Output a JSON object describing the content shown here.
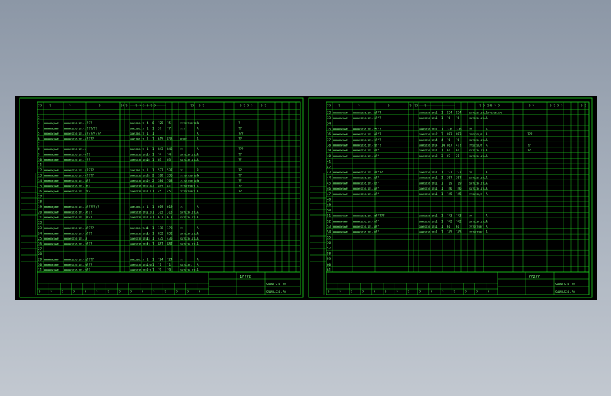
{
  "viewer": {
    "background_color": "#000000",
    "line_color": "#1fd61f",
    "text_color": "#7dff7d"
  },
  "sheets": [
    {
      "id": "sheet-left",
      "title_block": {
        "drawing_no": "SWWHLS38.78",
        "name_line": "1???2",
        "header_codes": [
          "7?",
          "?",
          "?",
          "?",
          "??",
          "?",
          "? ? ? ? ? ?",
          "??",
          "? ?",
          "? ? ? ?",
          "? ?"
        ],
        "footer_codes": [
          "?",
          "?",
          "?",
          "?",
          "?",
          "?",
          "?",
          "?",
          "?",
          "?",
          "?",
          "?",
          "?",
          "?",
          "?"
        ]
      },
      "rows": [
        {
          "n": "1"
        },
        {
          "n": "2"
        },
        {
          "n": "3",
          "a": "WWWWWW/WWW",
          "b": "WWWWHSJ36.17L-1",
          "c": "???",
          "d": "SAWSJ36.17",
          "q": "4",
          "u": "6",
          "v": "?25",
          "w": "?5",
          "x": "???SV7SB/?JLA",
          "y": "A",
          "z": "?"
        },
        {
          "n": "4",
          "a": "WWWWWW/WWW",
          "b": "WWWWHSJ36.17L-2",
          "c": "???/??",
          "d": "SAWSJ36.17",
          "q": "1",
          "u": "1",
          "v": "3?",
          "w": "?7",
          "x": "???",
          "y": "A",
          "z": "??"
        },
        {
          "n": "5",
          "a": "WWWWWW/WWW",
          "b": "WWWWHSJ36.17L-3",
          "c": "????/???",
          "d": "SAWSJ36.17",
          "q": "1",
          "u": "1",
          "v": "",
          "w": "",
          "x": "",
          "y": "A",
          "z": "???"
        },
        {
          "n": "6",
          "a": "WWWWWW/WWW",
          "b": "WWWWHSJ36.17L-4",
          "c": "????",
          "d": "SAWSJ36.17",
          "q": "1",
          "u": "1",
          "v": "615",
          "w": "835",
          "x": "838/3",
          "y": "A",
          "z": "??"
        },
        {
          "n": "7"
        },
        {
          "n": "8",
          "a": "WWWWWW/WWW",
          "b": "WWWWHSJ36.17L-5",
          "c": "",
          "d": "SAWSJ36.17",
          "q": "1",
          "u": "1",
          "v": "843",
          "w": "843",
          "x": "??",
          "y": "A",
          "z": "???"
        },
        {
          "n": "9",
          "a": "WWWWWW/WWW",
          "b": "WWWWHSJ36.17L-6",
          "c": "??",
          "d": "SAWHSJ36.17L-5",
          "q": "1",
          "u": "1",
          "v": "?4",
          "w": "?4",
          "x": "SA?SJ36.17LA",
          "y": "A",
          "z": "??"
        },
        {
          "n": "10",
          "a": "WWWWWW/WWW",
          "b": "WWWWHSJ36.17L-7",
          "c": "??",
          "d": "SAWHSJ36.17L-6",
          "q": "1",
          "u": "1",
          "v": "03",
          "w": "03",
          "x": "SA?SJ36.17LA",
          "y": "A",
          "z": "??"
        },
        {
          "n": "11"
        },
        {
          "n": "12",
          "a": "WWWWWW/WWW",
          "b": "WWWWHSJ36.17L-8",
          "c": "????",
          "d": "SAWSJ36.17",
          "q": "1",
          "u": "1",
          "v": "537",
          "w": "537",
          "x": "??",
          "y": "B",
          "z": "??"
        },
        {
          "n": "13",
          "a": "WWWWWW/WWW",
          "b": "WWWWHSJ36.17L-9",
          "c": "????",
          "d": "SAWHSJ36.17L-8",
          "q": "2",
          "u": "2",
          "v": "168",
          "w": "336",
          "x": "???SV7SB/?JLA",
          "y": "A",
          "z": "??"
        },
        {
          "n": "14",
          "a": "WWWWWW/WWW",
          "b": "WWWWHSJ36.17L-10",
          "c": "??",
          "d": "SAWHSJ36.17L-9",
          "q": "2",
          "u": "2",
          "v": "384",
          "w": "768",
          "x": "???SV7SB/?JLA",
          "y": "A",
          "z": "??"
        },
        {
          "n": "15",
          "a": "WWWWWW/WWW",
          "b": "WWWWHSJ36.17L-11",
          "c": "??",
          "d": "SAWHSJ36.17L-10",
          "q": "2",
          "u": "2",
          "v": "405",
          "w": "81",
          "x": "???SV7SB/?",
          "y": "A",
          "z": "??"
        },
        {
          "n": "16",
          "a": "WWWWWW/WWW",
          "b": "WWWWHSJ36.17L-12",
          "c": "??",
          "d": "SAWHSJ36.17L-11",
          "q": "1",
          "u": "1",
          "v": "45",
          "w": "45",
          "x": "???SV7SB/?",
          "y": "A",
          "z": "??"
        },
        {
          "n": "17"
        },
        {
          "n": "18"
        },
        {
          "n": "19",
          "a": "WWWWWW/WWW",
          "b": "WWWWHSJ36.17L-13",
          "c": "?????/?",
          "d": "SAWSJ36.17",
          "q": "1",
          "u": "1",
          "v": "619",
          "w": "619",
          "x": "??",
          "y": "A"
        },
        {
          "n": "20",
          "a": "WWWWWW/WWW",
          "b": "WWWWHSJ36.17L-14",
          "c": "???",
          "d": "SAWHSJ36.17L-13",
          "q": "1",
          "u": "1",
          "v": "315",
          "w": "315",
          "x": "SA?SJ36.17LA",
          "y": "A"
        },
        {
          "n": "21",
          "a": "WWWWWW/WWW",
          "b": "WWWWHSJ36.17L-15",
          "c": "???",
          "d": "SAWHSJ36.17L-14",
          "q": "1",
          "u": "1",
          "v": "6.?",
          "w": "6.?",
          "x": "SA?SJ36.17LA",
          "y": "A"
        },
        {
          "n": "22"
        },
        {
          "n": "23",
          "a": "WWWWWW/WWW",
          "b": "WWWWHSJ36.17L-16",
          "c": "????",
          "d": "SAWSJ36.17L12",
          "q": "1",
          "u": "1",
          "v": "1?8",
          "w": "1?8",
          "x": "??",
          "y": "A"
        },
        {
          "n": "24",
          "a": "WWWWWW/WWW",
          "b": "WWWWHSJ36.17L-17",
          "c": "???",
          "d": "SAWHSJ36.17L13",
          "q": "1",
          "u": "1",
          "v": "032",
          "w": "032",
          "x": "SA?SJ36.17LA",
          "y": "A"
        },
        {
          "n": "25",
          "a": "WWWWWW/WWW",
          "b": "WWWWHSJ36.17L-18",
          "c": "",
          "d": "SAWHSJ36.17L13",
          "q": "1",
          "u": "1",
          "v": "435",
          "w": "435",
          "x": "SA?SJ36.17LA",
          "y": "A"
        },
        {
          "n": "26",
          "a": "WWWWWW/WWW",
          "b": "WWWWHSJ36.17L-19",
          "c": "???",
          "d": "SAWHSJ36.17L13",
          "q": "1",
          "u": "1",
          "v": "887",
          "w": "887",
          "x": "SA?SJ36.17LA",
          "y": "A"
        },
        {
          "n": "27"
        },
        {
          "n": "28"
        },
        {
          "n": "29",
          "a": "WWWWWW/WWW",
          "b": "WWWWHSJ36.17L-20",
          "c": "????",
          "d": "SAWSJ36.17",
          "q": "1",
          "u": "1",
          "v": "?24",
          "w": "?24",
          "x": "??",
          "y": "A"
        },
        {
          "n": "30",
          "a": "WWWWWW/WWW",
          "b": "WWWWHSJ36.17L-21",
          "c": "???",
          "d": "SAWHSJ36.17L-20",
          "q": "1",
          "u": "1",
          "v": "?1",
          "w": "?1",
          "x": "SA?SJ36.",
          "y": "A"
        },
        {
          "n": "31",
          "a": "WWWWWW/WWW",
          "b": "WWWWHSJ36.17L-22",
          "c": "??",
          "d": "SAWHSJ36.17L-21",
          "q": "1",
          "u": "1",
          "v": "?9",
          "w": "?9",
          "x": "SA?SJ36.17LA",
          "y": "A"
        }
      ]
    },
    {
      "id": "sheet-right",
      "title_block": {
        "drawing_no": "SWWHLS38.78",
        "name_line": "??2??",
        "header_codes": [
          "7?",
          "?",
          "?",
          "?",
          "?",
          "??",
          "?",
          "? ? ? ? ? ?",
          "??",
          "? ?",
          "? ? ? ?",
          "? ?"
        ],
        "footer_codes": [
          "?",
          "?",
          "?",
          "?",
          "?",
          "?",
          "?",
          "?",
          "?",
          "?",
          "?",
          "?",
          "?",
          "?",
          "?"
        ]
      },
      "rows": [
        {
          "n": "32",
          "a": "WWWWWW/WWW",
          "b": "WWWWHSJ36.17L-23",
          "c": "???",
          "d": "SAWHSJ36.17L",
          "q": "1",
          "u": "1",
          "v": "524",
          "w": "524",
          "x": "SA?SJ36.17LA/??SJ36.17L",
          "y": "A"
        },
        {
          "n": "33",
          "a": "WWWWWW/WWW",
          "b": "WWWWHSJ36.17L-24",
          "c": "???",
          "d": "SAWHSJ36.17L",
          "q": "1",
          "u": "1",
          "v": "?6",
          "w": "?6",
          "x": "SA?SJ36.17LA",
          "y": "A"
        },
        {
          "n": "34"
        },
        {
          "n": "35",
          "a": "WWWWWW/WWW",
          "b": "WWWWHSJ36.17L-25",
          "c": "???",
          "d": "SAWHSJ36.17L",
          "q": "1",
          "u": "1",
          "v": "3.6",
          "w": "3.6",
          "x": "??",
          "y": "A"
        },
        {
          "n": "36",
          "a": "WWWWWW/WWW",
          "b": "WWWWHSJ36.17L-26",
          "c": "???",
          "d": "SAWHSJ36.17L",
          "q": "2",
          "u": "2",
          "v": "883",
          "w": "883",
          "x": "??SV7SB/?",
          "y": "A",
          "z": "???"
        },
        {
          "n": "37",
          "a": "WWWWWW/WWW",
          "b": "WWWWHSJ36.17L-27",
          "c": "???",
          "d": "SAWHSJ36.17L",
          "q": "4",
          "u": "4",
          "v": "?6",
          "w": "?6",
          "x": "SA?SJ36.17LA",
          "y": "A"
        },
        {
          "n": "38",
          "a": "WWWWWW/WWW",
          "b": "WWWWHSJ36.17L-28",
          "c": "???",
          "d": "SAWHSJ36.17L",
          "q": "4",
          "u": "14",
          "v": "867",
          "w": "4??",
          "x": "??SV7SB/?",
          "y": "A",
          "z": "??"
        },
        {
          "n": "39",
          "a": "WWWWWW/WWW",
          "b": "WWWWHSJ36.17L-29",
          "c": "??",
          "d": "SAWHSJ36.17L",
          "q": "1",
          "u": "1",
          "v": "61",
          "w": "61",
          "x": "SA?SJ36.17LA",
          "y": "A",
          "z": "??"
        },
        {
          "n": "40",
          "a": "WWWWWW/WWW",
          "b": "WWWWHSJ36.17L-30",
          "c": "??",
          "d": "SAWHSJ36.17L",
          "q": "3",
          "u": "3",
          "v": "07",
          "w": "21",
          "x": "SA?SJ36.17LA",
          "y": "A"
        },
        {
          "n": "41"
        },
        {
          "n": "42"
        },
        {
          "n": "43",
          "a": "WWWWWW/WWW",
          "b": "WWWWHSJ36.17L-31",
          "c": "????",
          "d": "SAWHSJ36.17L",
          "q": "1",
          "u": "1",
          "v": "?27",
          "w": "?27",
          "x": "??",
          "y": "A"
        },
        {
          "n": "44",
          "a": "WWWWWW/WWW",
          "b": "WWWWHSJ36.17L-32",
          "c": "??",
          "d": "SAWHSJ36.17L",
          "q": "1",
          "u": "1",
          "v": "36?",
          "w": "36?",
          "x": "SA?SJ36.17LA",
          "y": "A"
        },
        {
          "n": "45",
          "a": "WWWWWW/WWW",
          "b": "WWWWHSJ36.17L-33",
          "c": "??",
          "d": "SAWHSJ36.17L",
          "q": "1",
          "u": "1",
          "v": "?19",
          "w": "?19",
          "x": "SA?SJ36.17LA",
          "y": "A"
        },
        {
          "n": "46",
          "a": "WWWWWW/WWW",
          "b": "WWWWHSJ36.17L-34",
          "c": "??",
          "d": "SAWHSJ36.17L",
          "q": "1",
          "u": "1",
          "v": "?46",
          "w": "?46",
          "x": "SA?SJ36.17LA",
          "y": "A"
        },
        {
          "n": "47",
          "a": "WWWWWW/WWW",
          "b": "WWWWHSJ36.17L-35",
          "c": "??",
          "d": "SAWHSJ36.17L",
          "q": "1",
          "u": "1",
          "v": "?45",
          "w": "?45",
          "x": "??SV7SB/?",
          "y": "A"
        },
        {
          "n": "48"
        },
        {
          "n": "49"
        },
        {
          "n": "50"
        },
        {
          "n": "51",
          "a": "WWWWWW/WWW",
          "b": "WWWWHSJ36.17L-36",
          "c": "?????",
          "d": "SAWHSJ36.17L",
          "q": "1",
          "u": "1",
          "v": "?43",
          "w": "?43",
          "x": "??",
          "y": "A"
        },
        {
          "n": "52",
          "a": "WWWWWW/WWW",
          "b": "WWWWHSJ36.17L-37",
          "c": "??",
          "d": "SAWHSJ36.17L",
          "q": "1",
          "u": "1",
          "v": "?42",
          "w": "?42",
          "x": "SA?SJ36.17LA",
          "y": "A"
        },
        {
          "n": "53",
          "a": "WWWWWW/WWW",
          "b": "WWWWHSJ36.17L-38",
          "c": "??",
          "d": "SAWHSJ36.17L",
          "q": "1",
          "u": "1",
          "v": "61",
          "w": "61",
          "x": "???SV7SB/?",
          "y": "A"
        },
        {
          "n": "54",
          "a": "WWWWWW/WWW",
          "b": "WWWWHSJ36.17L-39",
          "c": "??",
          "d": "SAWHSJ36.17L",
          "q": "1",
          "u": "1",
          "v": "?45",
          "w": "?45",
          "x": "???SV7SB/?",
          "y": "A"
        },
        {
          "n": "55"
        },
        {
          "n": "56"
        },
        {
          "n": "57"
        },
        {
          "n": "58"
        },
        {
          "n": "59"
        },
        {
          "n": "60"
        },
        {
          "n": "61"
        }
      ]
    }
  ]
}
